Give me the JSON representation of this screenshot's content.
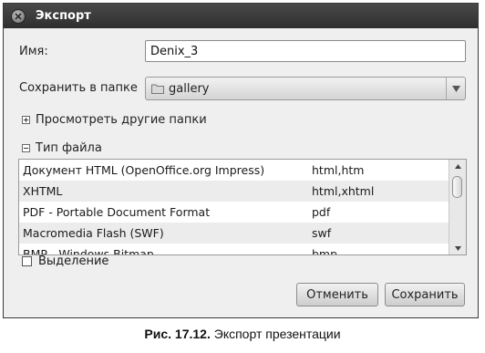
{
  "window": {
    "title": "Экспорт"
  },
  "form": {
    "name_label": "Имя:",
    "name_value": "Denix_3",
    "folder_label": "Сохранить в папке",
    "folder_value": "gallery"
  },
  "browse_expander": {
    "symbol": "+",
    "label": "Просмотреть другие папки"
  },
  "filetype_expander": {
    "symbol": "−",
    "label": "Тип файла"
  },
  "file_types": [
    {
      "name": "Документ HTML (OpenOffice.org Impress)",
      "ext": "html,htm"
    },
    {
      "name": "XHTML",
      "ext": "html,xhtml"
    },
    {
      "name": "PDF - Portable Document Format",
      "ext": "pdf"
    },
    {
      "name": "Macromedia Flash (SWF)",
      "ext": "swf"
    },
    {
      "name": "BMP - Windows Bitmap",
      "ext": "bmp"
    }
  ],
  "selection_checkbox": {
    "label": "Выделение",
    "checked": false
  },
  "buttons": {
    "cancel": "Отменить",
    "save": "Сохранить"
  },
  "caption": {
    "prefix": "Рис. 17.12.",
    "text": "Экспорт презентации"
  },
  "colors": {
    "titlebar": "#3a3a3a",
    "dialog_bg": "#efefef",
    "list_alt_row": "#ececec"
  }
}
